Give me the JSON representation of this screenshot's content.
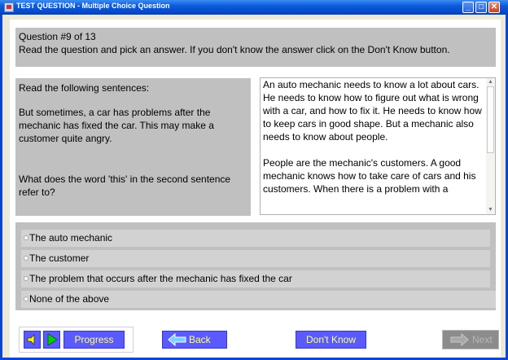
{
  "window": {
    "title": "TEST QUESTION - Multiple Choice Question",
    "controls": {
      "minimize": "_",
      "maximize": "□",
      "close": "✕"
    }
  },
  "header": {
    "question_number": "Question #9 of 13",
    "instructions": "Read the question and pick an answer. If you don't know the answer click on the Don't Know button."
  },
  "prompt": {
    "intro": "Read the following sentences:",
    "sentences": "But sometimes, a car has problems after the mechanic has fixed the car. This may make a customer quite angry.",
    "question": "What does the word 'this' in the second sentence refer to?"
  },
  "passage": {
    "paragraphs": [
      "An auto mechanic needs to know a lot about cars. He needs to know how to figure out what is wrong with a car, and how to fix it. He needs to know how to keep cars in good shape. But a mechanic also needs to know about people.",
      "People are the mechanic's customers. A good mechanic knows how to take care of cars and his customers. When there is a problem with a"
    ]
  },
  "answers": {
    "options": [
      "The auto mechanic",
      "The customer",
      "The problem that occurs after the mechanic has fixed the car",
      "None of the above"
    ]
  },
  "toolbar": {
    "progress_label": "Progress",
    "back_label": "Back",
    "dont_know_label": "Don't Know",
    "next_label": "Next"
  },
  "icons": {
    "sound": "speaker-icon",
    "play": "play-icon",
    "back": "left-arrow-icon",
    "next": "right-arrow-icon"
  },
  "colors": {
    "title_bar": "#0A5BDB",
    "panel_gray": "#C0C0C0",
    "button_blue": "#5A5AFF",
    "button_text": "#FFFF80",
    "disabled_button": "#8C8C8C"
  }
}
